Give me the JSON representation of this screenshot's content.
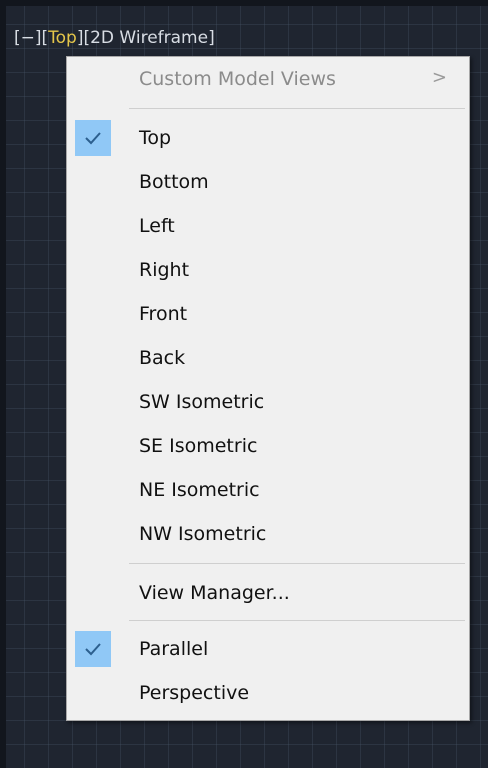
{
  "viewport": {
    "minus_label": "[−]",
    "view_open": "[",
    "view_label": "Top",
    "view_close": "]",
    "visual_style_label": "[2D Wireframe]",
    "accent_color": "#e4c64a"
  },
  "menu": {
    "custom_views_label": "Custom Model Views",
    "submenu_arrow": ">",
    "views": [
      "Top",
      "Bottom",
      "Left",
      "Right",
      "Front",
      "Back",
      "SW Isometric",
      "SE Isometric",
      "NE Isometric",
      "NW Isometric"
    ],
    "checked_view": "Top",
    "view_manager_label": "View Manager...",
    "projection": [
      "Parallel",
      "Perspective"
    ],
    "checked_projection": "Parallel",
    "check_color": "#90c8f6"
  }
}
